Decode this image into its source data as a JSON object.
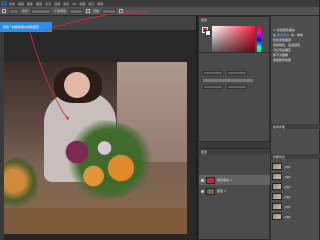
{
  "app": {
    "menus": [
      "文件",
      "编辑",
      "图像",
      "图层",
      "文字",
      "选择",
      "滤镜",
      "3D",
      "视图",
      "窗口",
      "帮助"
    ]
  },
  "options_bar": {
    "mode_label": "模式:",
    "opacity_label": "不透明度:",
    "flow_label": "流量:"
  },
  "canvas": {
    "tooltip_text": "新建一种颜色填充调整图层"
  },
  "color_panel": {
    "tab_label": "颜色",
    "foreground_color": "#c22a3d",
    "background_color": "#ffffff"
  },
  "layers_panel": {
    "tabs_label": "图层",
    "layers": [
      {
        "name": "颜色填充 1",
        "thumb_color": "#c22a3d"
      },
      {
        "name": "图层 1",
        "thumb_color": "#7b6352"
      }
    ]
  },
  "right_column": {
    "step_title": "3. 新建颜色填充",
    "step_text_1": "在",
    "step_highlight_1": "图层面板",
    "step_text_2": "中，单击",
    "step_line_2": "新建调整图层",
    "step_line_3": "选择纯色，设置颜色",
    "step_line_4": "为红色后确定",
    "step_line_5": "即可为图像",
    "step_line_6": "添加颜色效果",
    "section_header": "操作步骤",
    "list_header": "步骤列表",
    "thumb_items": [
      "步骤1",
      "步骤2",
      "步骤3",
      "步骤4",
      "步骤5",
      "步骤6"
    ]
  }
}
